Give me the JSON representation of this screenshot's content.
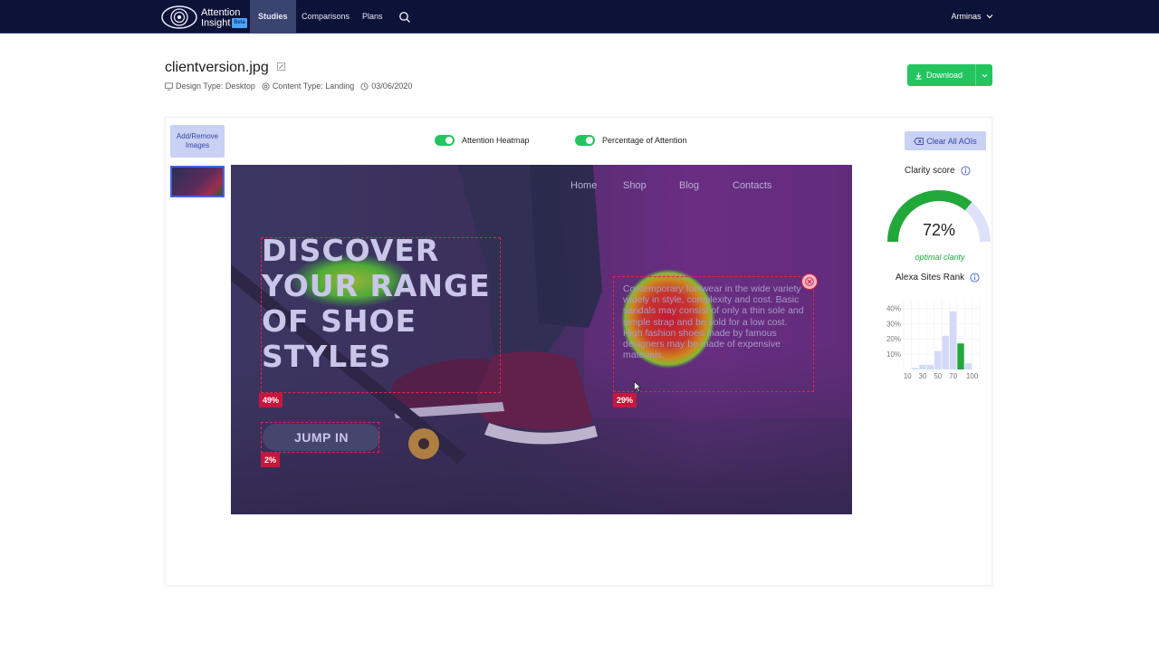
{
  "nav": {
    "logo_line1": "Attention",
    "logo_line2": "Insight",
    "logo_badge": "Beta",
    "items": [
      {
        "label": "Studies",
        "active": true
      },
      {
        "label": "Comparisons",
        "active": false
      },
      {
        "label": "Plans",
        "active": false
      }
    ],
    "user": "Arminas"
  },
  "header": {
    "file_title": "clientversion.jpg",
    "design_type": "Design Type: Desktop",
    "content_type": "Content Type: Landing",
    "date": "03/06/2020",
    "download_label": "Download"
  },
  "toolbar": {
    "add_remove_line1": "Add/Remove",
    "add_remove_line2": "Images",
    "heatmap_toggle": "Attention Heatmap",
    "percentage_toggle": "Percentage of Attention",
    "clear_label": "Clear All AOIs"
  },
  "canvas": {
    "site_nav": [
      "Home",
      "Shop",
      "Blog",
      "Contacts"
    ],
    "headline": [
      "DISCOVER",
      "YOUR RANGE",
      "OF SHOE",
      "STYLES"
    ],
    "body_text": "Contemporary footwear in the wide variety widely in style, complexity and cost. Basic sandals may consist of only a thin sole and simple strap and be sold for a low cost. High fashion shoes made by famous designers may be made of expensive materials.",
    "button": "JUMP IN",
    "aoi": [
      {
        "label": "49%"
      },
      {
        "label": "29%"
      },
      {
        "label": "2%"
      }
    ]
  },
  "clarity": {
    "title": "Clarity score",
    "value": "72%",
    "fraction": 0.72,
    "status": "optimal clarity",
    "color": "#22a83a"
  },
  "alexa": {
    "title": "Alexa Sites Rank",
    "y_ticks": [
      "40%",
      "30%",
      "20%",
      "10%"
    ],
    "x_ticks": [
      "10",
      "30",
      "50",
      "70",
      "100"
    ]
  },
  "chart_data": {
    "type": "bar",
    "title": "Alexa Sites Rank",
    "categories": [
      "10",
      "20",
      "30",
      "40",
      "50",
      "60",
      "70",
      "80",
      "90",
      "100"
    ],
    "values": [
      0,
      1,
      3,
      3,
      12,
      22,
      38,
      17,
      4,
      0
    ],
    "highlight_index": 7,
    "ylim": [
      0,
      45
    ],
    "yticks": [
      "40%",
      "30%",
      "20%",
      "10%"
    ],
    "xticks": [
      "10",
      "30",
      "50",
      "70",
      "100"
    ],
    "colors": {
      "bar": "#d4d9f7",
      "highlight": "#22a83a"
    }
  }
}
